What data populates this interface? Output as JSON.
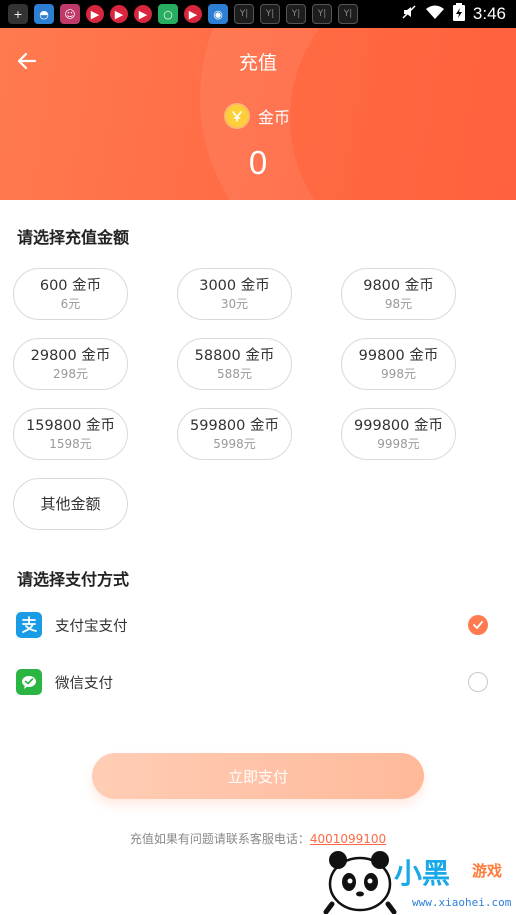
{
  "status_bar": {
    "time": "3:46",
    "notif_y_label": "Y|"
  },
  "header": {
    "title": "充值",
    "coin_label": "金币",
    "balance": "0"
  },
  "amount_section": {
    "title": "请选择充值金额",
    "options": [
      {
        "amount": "600 金币",
        "price": "6元"
      },
      {
        "amount": "3000 金币",
        "price": "30元"
      },
      {
        "amount": "9800 金币",
        "price": "98元"
      },
      {
        "amount": "29800 金币",
        "price": "298元"
      },
      {
        "amount": "58800 金币",
        "price": "588元"
      },
      {
        "amount": "99800 金币",
        "price": "998元"
      },
      {
        "amount": "159800 金币",
        "price": "1598元"
      },
      {
        "amount": "599800 金币",
        "price": "5998元"
      },
      {
        "amount": "999800 金币",
        "price": "9998元"
      }
    ],
    "other_label": "其他金额"
  },
  "payment_section": {
    "title": "请选择支付方式",
    "methods": [
      {
        "label": "支付宝支付",
        "icon": "alipay-icon",
        "selected": true
      },
      {
        "label": "微信支付",
        "icon": "wechat-pay-icon",
        "selected": false
      }
    ]
  },
  "pay_button": {
    "label": "立即支付"
  },
  "footer": {
    "note": "充值如果有问题请联系客服电话：",
    "phone": "4001099100"
  },
  "watermark": {
    "name": "小黑",
    "sub": "游戏",
    "url": "www.xiaohei.com"
  },
  "colors": {
    "accent": "#ff6a44",
    "pay_button": "#ffbfa2",
    "alipay": "#1a9be6",
    "wechat": "#2bb543"
  }
}
